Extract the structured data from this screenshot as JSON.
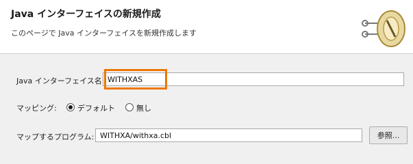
{
  "header": {
    "title": "Java インターフェイスの新規作成",
    "description": "このページで Java インターフェイスを新規作成します"
  },
  "form": {
    "interface_name_label": "Java インターフェイス名:",
    "interface_name_value": "WITHXAS",
    "mapping_label": "マッピング:",
    "mapping_options": [
      {
        "label": "デフォルト",
        "selected": true
      },
      {
        "label": "無し",
        "selected": false
      }
    ],
    "program_label": "マップするプログラム:",
    "program_value": "WITHXA/withxa.cbl",
    "browse_label": "参照..."
  },
  "colors": {
    "highlight": "#ee7700",
    "header_bg": "#ffffff",
    "body_bg": "#f0f0f0"
  },
  "icons": [
    "wizard-key-icon"
  ]
}
